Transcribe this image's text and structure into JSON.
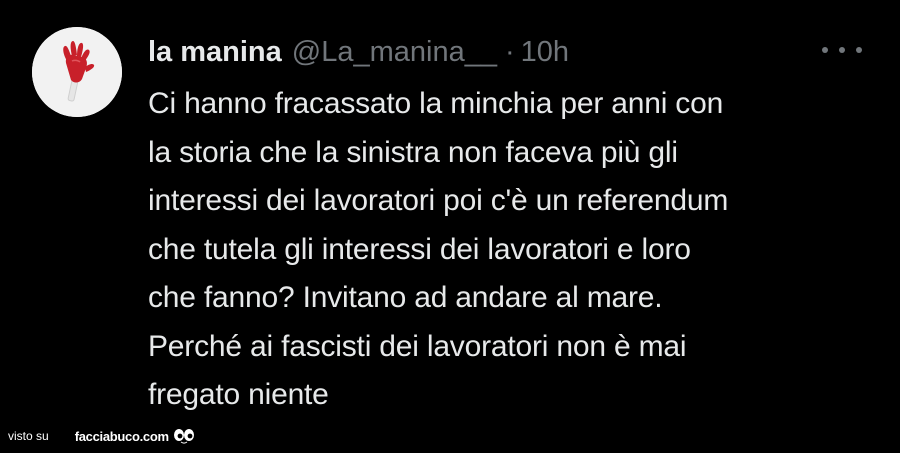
{
  "tweet": {
    "author": {
      "display_name": "la manina",
      "handle": "@La_manina__",
      "avatar_icon": "hand-icon"
    },
    "separator": "·",
    "time": "10h",
    "more_icon": "more-options-icon",
    "text": "Ci hanno fracassato la minchia per anni con\nla storia che la sinistra non faceva più gli\ninteressi dei lavoratori poi c'è un referendum\nche tutela gli interessi dei lavoratori e loro\nche fanno? Invitano ad andare al mare.\nPerché ai fascisti dei lavoratori non è mai\nfregato niente"
  },
  "watermark": {
    "prefix": "visto su",
    "site": "facciabuco.com",
    "logo_icon": "eyes-icon"
  },
  "colors": {
    "background": "#000000",
    "text": "#e7e9ea",
    "secondary": "#71767b",
    "avatar_bg": "#f2f2f2",
    "hand": "#c8202a"
  }
}
